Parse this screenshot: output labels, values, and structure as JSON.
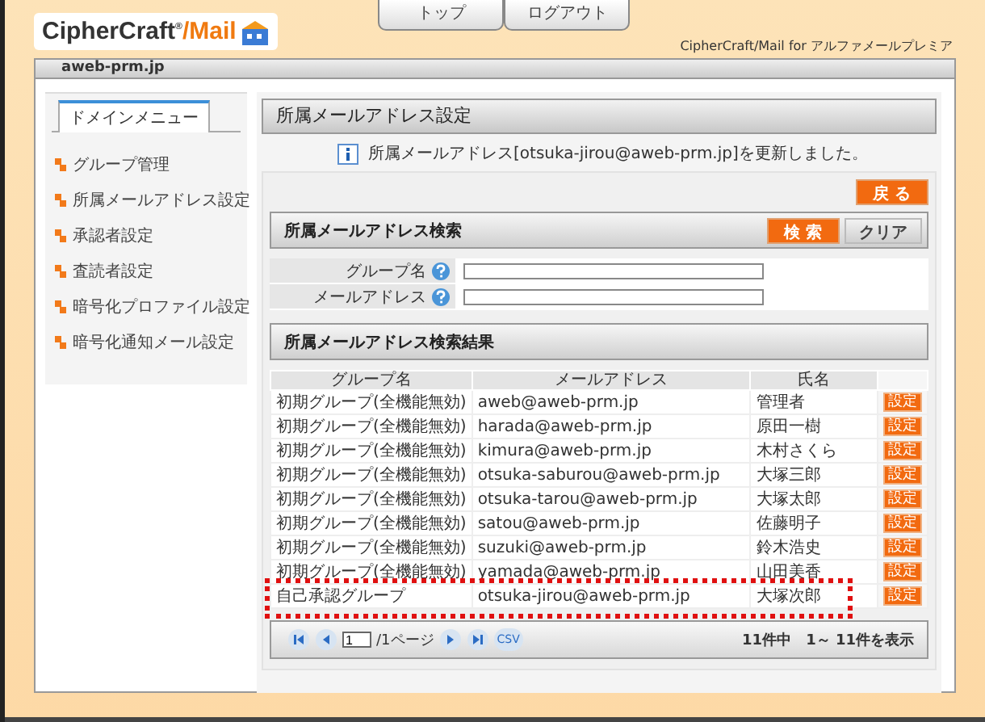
{
  "header": {
    "logo": {
      "name": "CipherCraft",
      "mark": "®",
      "suffix": "/Mail"
    },
    "nav": [
      {
        "label": "トップ"
      },
      {
        "label": "ログアウト"
      }
    ],
    "caption": "CipherCraft/Mail for アルファメールプレミア"
  },
  "domain": "aweb-prm.jp",
  "sidebar": {
    "tab": "ドメインメニュー",
    "items": [
      "グループ管理",
      "所属メールアドレス設定",
      "承認者設定",
      "査読者設定",
      "暗号化プロファイル設定",
      "暗号化通知メール設定"
    ]
  },
  "main": {
    "title": "所属メールアドレス設定",
    "message": "所属メールアドレス[otsuka-jirou@aweb-prm.jp]を更新しました。",
    "back_button": "戻 る",
    "search": {
      "title": "所属メールアドレス検索",
      "search_button": "検 索",
      "clear_button": "クリア",
      "fields": [
        {
          "label": "グループ名"
        },
        {
          "label": "メールアドレス"
        }
      ]
    },
    "results": {
      "title": "所属メールアドレス検索結果",
      "columns": [
        "グループ名",
        "メールアドレス",
        "氏名"
      ],
      "rows": [
        {
          "group": "初期グループ(全機能無効)",
          "email": "aweb@aweb-prm.jp",
          "name": "管理者",
          "action": "設定",
          "highlighted": false
        },
        {
          "group": "初期グループ(全機能無効)",
          "email": "harada@aweb-prm.jp",
          "name": "原田一樹",
          "action": "設定",
          "highlighted": false
        },
        {
          "group": "初期グループ(全機能無効)",
          "email": "kimura@aweb-prm.jp",
          "name": "木村さくら",
          "action": "設定",
          "highlighted": false
        },
        {
          "group": "初期グループ(全機能無効)",
          "email": "otsuka-saburou@aweb-prm.jp",
          "name": "大塚三郎",
          "action": "設定",
          "highlighted": false
        },
        {
          "group": "初期グループ(全機能無効)",
          "email": "otsuka-tarou@aweb-prm.jp",
          "name": "大塚太郎",
          "action": "設定",
          "highlighted": false
        },
        {
          "group": "初期グループ(全機能無効)",
          "email": "satou@aweb-prm.jp",
          "name": "佐藤明子",
          "action": "設定",
          "highlighted": false
        },
        {
          "group": "初期グループ(全機能無効)",
          "email": "suzuki@aweb-prm.jp",
          "name": "鈴木浩史",
          "action": "設定",
          "highlighted": false
        },
        {
          "group": "初期グループ(全機能無効)",
          "email": "yamada@aweb-prm.jp",
          "name": "山田美香",
          "action": "設定",
          "highlighted": false
        },
        {
          "group": "自己承認グループ",
          "email": "otsuka-jirou@aweb-prm.jp",
          "name": "大塚次郎",
          "action": "設定",
          "highlighted": true
        }
      ],
      "pager": {
        "page": "1",
        "pages": "/1ページ",
        "csv": "CSV",
        "summary": "11件中　1～ 11件を表示"
      }
    }
  }
}
